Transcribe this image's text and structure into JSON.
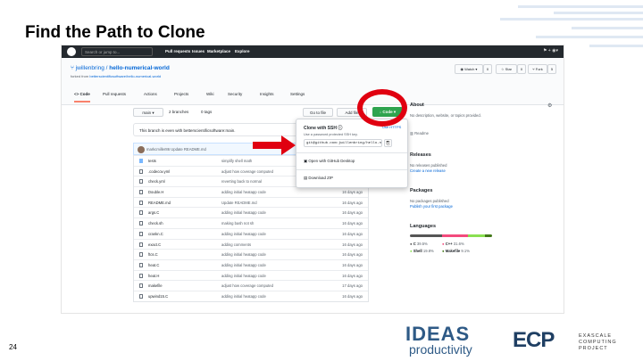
{
  "slide": {
    "title": "Find the Path to Clone",
    "number": "24"
  },
  "github": {
    "topbar": {
      "search_placeholder": "Search or jump to...",
      "nav": [
        "Pull requests",
        "Issues",
        "Marketplace",
        "Explore"
      ],
      "right": "⚑ + ◉▾"
    },
    "repo": {
      "owner": "jwillenbring",
      "separator": " / ",
      "name": "hello-numerical-world",
      "forked_prefix": "forked from ",
      "forked_from": "betterscientificsoftware/hello-numerical-world",
      "actions": [
        {
          "label": "◉ Watch ▾",
          "count": "0"
        },
        {
          "label": "☆ Star",
          "count": "0"
        },
        {
          "label": "⑂ Fork",
          "count": "5"
        }
      ]
    },
    "tabs": [
      "<> Code",
      "Pull requests",
      "Actions",
      "Projects",
      "Wiki",
      "Security",
      "Insights",
      "Settings"
    ],
    "toolbar": {
      "branch": "main ▾",
      "branches": "2 branches",
      "tags": "0 tags",
      "goto": "Go to file",
      "add": "Add file",
      "code": "↓ Code ▾"
    },
    "branch_status": "This branch is even with betterscientificsoftware:main.",
    "latest_commit": "markcmiller86 Update README.md",
    "files": [
      {
        "name": "tests",
        "msg": "simplify shell math",
        "age": "16 days ago"
      },
      {
        "name": ".codecov.yml",
        "msg": "adjust how coverage computed",
        "age": "15 days ago"
      },
      {
        "name": "check.yml",
        "msg": "reverting back to normal",
        "age": "16 days ago"
      },
      {
        "name": "Double.H",
        "msg": "adding initial heatapp code",
        "age": "16 days ago"
      },
      {
        "name": "README.md",
        "msg": "Update README.md",
        "age": "16 days ago"
      },
      {
        "name": "args.C",
        "msg": "adding initial heatapp code",
        "age": "16 days ago"
      },
      {
        "name": "check.sh",
        "msg": "making bash not sh",
        "age": "16 days ago"
      },
      {
        "name": "crankn.C",
        "msg": "adding initial heatapp code",
        "age": "16 days ago"
      },
      {
        "name": "exact.C",
        "msg": "adding comments",
        "age": "16 days ago"
      },
      {
        "name": "ftcs.C",
        "msg": "adding initial heatapp code",
        "age": "16 days ago"
      },
      {
        "name": "heat.C",
        "msg": "adding initial heatapp code",
        "age": "16 days ago"
      },
      {
        "name": "heat.H",
        "msg": "adding initial heatapp code",
        "age": "16 days ago"
      },
      {
        "name": "makefile",
        "msg": "adjust how coverage computed",
        "age": "17 days ago"
      },
      {
        "name": "upwind15.C",
        "msg": "adding initial heatapp code",
        "age": "16 days ago"
      }
    ],
    "popup": {
      "title": "Clone with SSH ⓘ",
      "use_https": "Use HTTPS",
      "subtitle": "Use a password protected SSH key.",
      "url": "git@github.com:jwillenbring/hello-n",
      "copy": "⎘",
      "desktop": "Open with GitHub Desktop",
      "zip": "Download ZIP"
    },
    "sidebar": {
      "about": "About",
      "about_desc": "No description, website, or topics provided.",
      "readme": "Readme",
      "releases": "Releases",
      "releases_none": "No releases published",
      "releases_link": "Create a new release",
      "packages": "Packages",
      "packages_none": "No packages published",
      "packages_link": "Publish your first package",
      "languages": "Languages",
      "lang_items": [
        {
          "name": "C",
          "pct": "39.5%",
          "color": "#555555"
        },
        {
          "name": "C++",
          "pct": "31.6%",
          "color": "#f34b7d"
        },
        {
          "name": "Shell",
          "pct": "19.8%",
          "color": "#89e051"
        },
        {
          "name": "Makefile",
          "pct": "9.1%",
          "color": "#427819"
        }
      ]
    }
  },
  "logos": {
    "ideas": "IDEAS",
    "productivity": "productivity",
    "ecp": "ECP",
    "ecp_text": [
      "EXASCALE",
      "COMPUTING",
      "PROJECT"
    ]
  },
  "annotation_colors": {
    "ring": "#e00010",
    "arrow": "#e00010"
  }
}
